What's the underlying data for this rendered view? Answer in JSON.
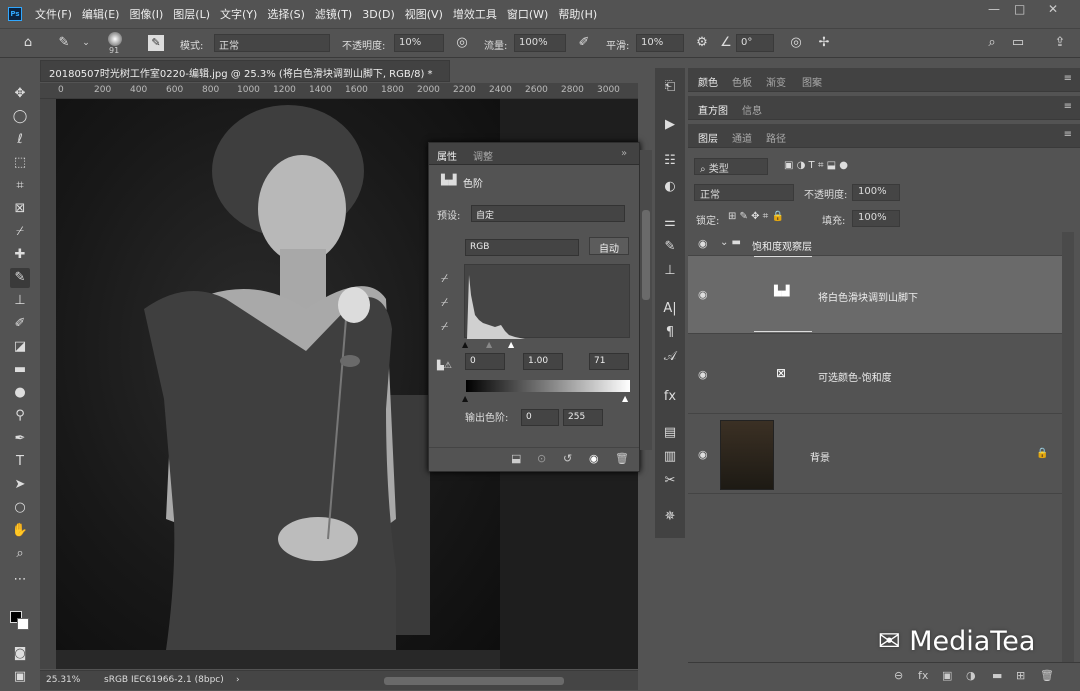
{
  "app": {
    "logo": "Ps"
  },
  "menu": [
    "文件(F)",
    "编辑(E)",
    "图像(I)",
    "图层(L)",
    "文字(Y)",
    "选择(S)",
    "滤镜(T)",
    "3D(D)",
    "视图(V)",
    "增效工具",
    "窗口(W)",
    "帮助(H)"
  ],
  "window_controls": [
    "—",
    "□",
    "✕"
  ],
  "options": {
    "brush_size": "91",
    "mode_label": "模式:",
    "mode_value": "正常",
    "opacity_label": "不透明度:",
    "opacity_value": "10%",
    "flow_label": "流量:",
    "flow_value": "100%",
    "smooth_label": "平滑:",
    "smooth_value": "10%",
    "angle_value": "0°"
  },
  "document": {
    "tab_title": "20180507时光树工作室0220-编辑.jpg @ 25.3% (将白色滑块调到山脚下, RGB/8) *",
    "ruler_ticks": [
      "0",
      "200",
      "400",
      "600",
      "800",
      "1000",
      "1200",
      "1400",
      "1600",
      "1800",
      "2000",
      "2200",
      "2400",
      "2600",
      "2800",
      "3000"
    ],
    "zoom": "25.31%",
    "profile": "sRGB IEC61966-2.1 (8bpc)"
  },
  "properties": {
    "tab_active": "属性",
    "tab_other": "调整",
    "type_label": "色阶",
    "preset_label": "预设:",
    "preset_value": "自定",
    "channel_value": "RGB",
    "auto_label": "自动",
    "input_black": "0",
    "input_gamma": "1.00",
    "input_white": "71",
    "output_label": "输出色阶:",
    "output_black": "0",
    "output_white": "255"
  },
  "right_panels": {
    "top_tabs": [
      "颜色",
      "色板",
      "渐变",
      "图案"
    ],
    "mid_tabs": [
      "直方图",
      "信息"
    ],
    "layer_tabs": [
      "图层",
      "通道",
      "路径"
    ]
  },
  "layers_panel": {
    "filter_value": "类型",
    "blend_mode": "正常",
    "opacity_label": "不透明度:",
    "opacity_value": "100%",
    "lock_label": "锁定:",
    "fill_label": "填充:",
    "fill_value": "100%",
    "group_name": "饱和度观察层",
    "layers": [
      {
        "name": "将白色滑块调到山脚下",
        "selected": true
      },
      {
        "name": "可选颜色-饱和度",
        "selected": false
      },
      {
        "name": "背景",
        "selected": false
      }
    ]
  },
  "watermark": "MediaTea",
  "colors": {
    "accent": "#31a8ff",
    "panel": "#535353",
    "selected_layer": "#6a6a6a"
  }
}
